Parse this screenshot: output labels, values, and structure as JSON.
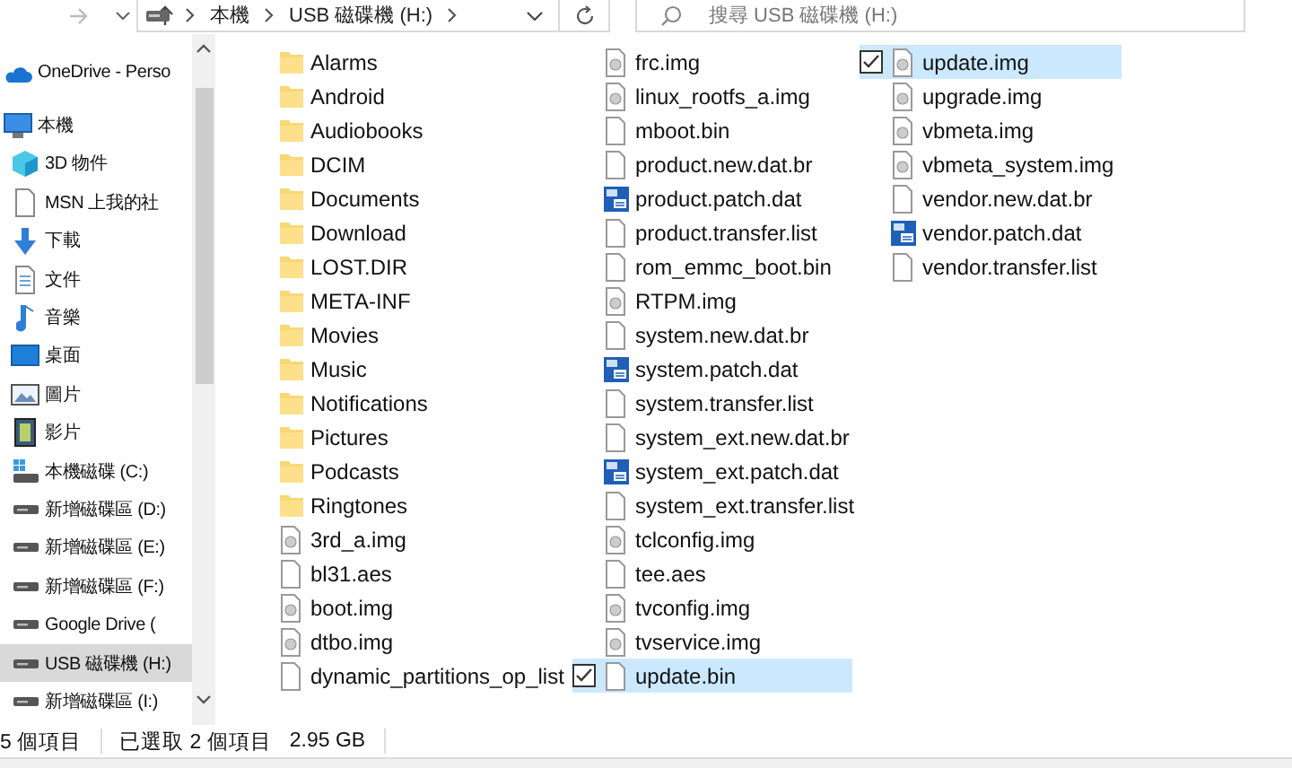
{
  "toolbar": {
    "breadcrumb": [
      "本機",
      "USB 磁碟機 (H:)"
    ],
    "search": {
      "placeholder": "搜尋 USB 磁碟機 (H:)"
    }
  },
  "sidebar": {
    "items": [
      {
        "label": "OneDrive - Perso",
        "kind": "cloud",
        "selected": false
      },
      {
        "label": "本機",
        "kind": "pc",
        "selected": false,
        "children": [
          {
            "label": "3D 物件",
            "kind": "cube",
            "selected": false
          },
          {
            "label": "MSN 上我的社",
            "kind": "page",
            "selected": false
          },
          {
            "label": "下載",
            "kind": "download",
            "selected": false
          },
          {
            "label": "文件",
            "kind": "document",
            "selected": false
          },
          {
            "label": "音樂",
            "kind": "music",
            "selected": false
          },
          {
            "label": "桌面",
            "kind": "desktop",
            "selected": false
          },
          {
            "label": "圖片",
            "kind": "picture",
            "selected": false
          },
          {
            "label": "影片",
            "kind": "video",
            "selected": false
          },
          {
            "label": "本機磁碟 (C:)",
            "kind": "system-drive",
            "selected": false
          },
          {
            "label": "新增磁碟區 (D:)",
            "kind": "drive",
            "selected": false
          },
          {
            "label": "新增磁碟區 (E:)",
            "kind": "drive",
            "selected": false
          },
          {
            "label": "新增磁碟區 (F:)",
            "kind": "drive",
            "selected": false
          },
          {
            "label": "Google Drive (",
            "kind": "drive",
            "selected": false
          },
          {
            "label": "USB 磁碟機 (H:)",
            "kind": "drive",
            "selected": true
          },
          {
            "label": "新增磁碟區 (I:)",
            "kind": "drive",
            "selected": false
          }
        ]
      }
    ]
  },
  "files": [
    {
      "name": "Alarms",
      "kind": "folder",
      "selected": false
    },
    {
      "name": "Android",
      "kind": "folder",
      "selected": false
    },
    {
      "name": "Audiobooks",
      "kind": "folder",
      "selected": false
    },
    {
      "name": "DCIM",
      "kind": "folder",
      "selected": false
    },
    {
      "name": "Documents",
      "kind": "folder",
      "selected": false
    },
    {
      "name": "Download",
      "kind": "folder",
      "selected": false
    },
    {
      "name": "LOST.DIR",
      "kind": "folder",
      "selected": false
    },
    {
      "name": "META-INF",
      "kind": "folder",
      "selected": false
    },
    {
      "name": "Movies",
      "kind": "folder",
      "selected": false
    },
    {
      "name": "Music",
      "kind": "folder",
      "selected": false
    },
    {
      "name": "Notifications",
      "kind": "folder",
      "selected": false
    },
    {
      "name": "Pictures",
      "kind": "folder",
      "selected": false
    },
    {
      "name": "Podcasts",
      "kind": "folder",
      "selected": false
    },
    {
      "name": "Ringtones",
      "kind": "folder",
      "selected": false
    },
    {
      "name": "3rd_a.img",
      "kind": "image",
      "selected": false
    },
    {
      "name": "bl31.aes",
      "kind": "file",
      "selected": false
    },
    {
      "name": "boot.img",
      "kind": "image",
      "selected": false
    },
    {
      "name": "dtbo.img",
      "kind": "image",
      "selected": false
    },
    {
      "name": "dynamic_partitions_op_list",
      "kind": "file",
      "selected": false
    },
    {
      "name": "frc.img",
      "kind": "image",
      "selected": false
    },
    {
      "name": "linux_rootfs_a.img",
      "kind": "image",
      "selected": false
    },
    {
      "name": "mboot.bin",
      "kind": "file",
      "selected": false
    },
    {
      "name": "product.new.dat.br",
      "kind": "file",
      "selected": false
    },
    {
      "name": "product.patch.dat",
      "kind": "dat",
      "selected": false
    },
    {
      "name": "product.transfer.list",
      "kind": "file",
      "selected": false
    },
    {
      "name": "rom_emmc_boot.bin",
      "kind": "file",
      "selected": false
    },
    {
      "name": "RTPM.img",
      "kind": "image",
      "selected": false
    },
    {
      "name": "system.new.dat.br",
      "kind": "file",
      "selected": false
    },
    {
      "name": "system.patch.dat",
      "kind": "dat",
      "selected": false
    },
    {
      "name": "system.transfer.list",
      "kind": "file",
      "selected": false
    },
    {
      "name": "system_ext.new.dat.br",
      "kind": "file",
      "selected": false
    },
    {
      "name": "system_ext.patch.dat",
      "kind": "dat",
      "selected": false
    },
    {
      "name": "system_ext.transfer.list",
      "kind": "file",
      "selected": false
    },
    {
      "name": "tclconfig.img",
      "kind": "image",
      "selected": false
    },
    {
      "name": "tee.aes",
      "kind": "file",
      "selected": false
    },
    {
      "name": "tvconfig.img",
      "kind": "image",
      "selected": false
    },
    {
      "name": "tvservice.img",
      "kind": "image",
      "selected": false
    },
    {
      "name": "update.bin",
      "kind": "file",
      "selected": true
    },
    {
      "name": "update.img",
      "kind": "image",
      "selected": true
    },
    {
      "name": "upgrade.img",
      "kind": "image",
      "selected": false
    },
    {
      "name": "vbmeta.img",
      "kind": "image",
      "selected": false
    },
    {
      "name": "vbmeta_system.img",
      "kind": "image",
      "selected": false
    },
    {
      "name": "vendor.new.dat.br",
      "kind": "file",
      "selected": false
    },
    {
      "name": "vendor.patch.dat",
      "kind": "dat",
      "selected": false
    },
    {
      "name": "vendor.transfer.list",
      "kind": "file",
      "selected": false
    }
  ],
  "status_bar": {
    "count": "5 個項目",
    "selection": "已選取 2 個項目",
    "size": "2.95 GB"
  }
}
